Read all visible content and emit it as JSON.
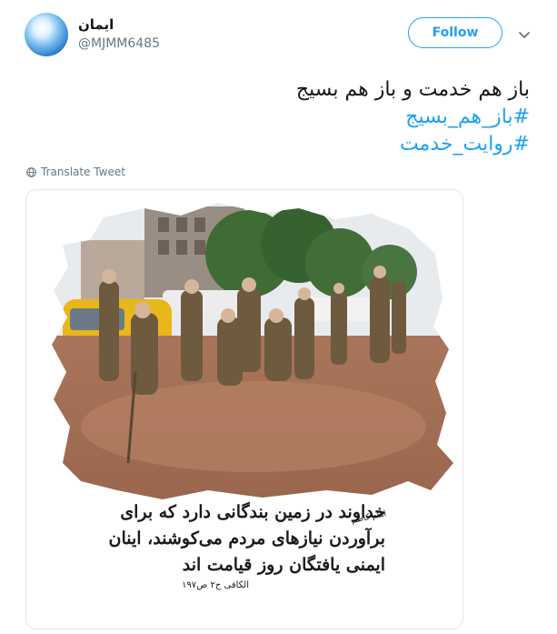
{
  "tweet": {
    "author": {
      "display_name": "ایمان",
      "handle": "@MJMM6485"
    },
    "follow_label": "Follow",
    "text_line": "باز هم خدمت و باز هم بسیج",
    "hashtags": [
      "#باز_هم_بسیج",
      "#روایت_خدمت"
    ],
    "translate_label": "Translate Tweet"
  },
  "media": {
    "caption_lines": [
      "خداوند در زمین بندگانی دارد که برای",
      "برآوردن نیازهای مردم می‌کوشند، اینان",
      "ایمنی یافتگان روز قیامت اند"
    ],
    "attribution": "امام کاظم",
    "source": "الکافی ج۲ ص۱۹۷"
  },
  "colors": {
    "accent": "#1da1f2",
    "muted": "#657786",
    "border": "#e1e8ed"
  }
}
